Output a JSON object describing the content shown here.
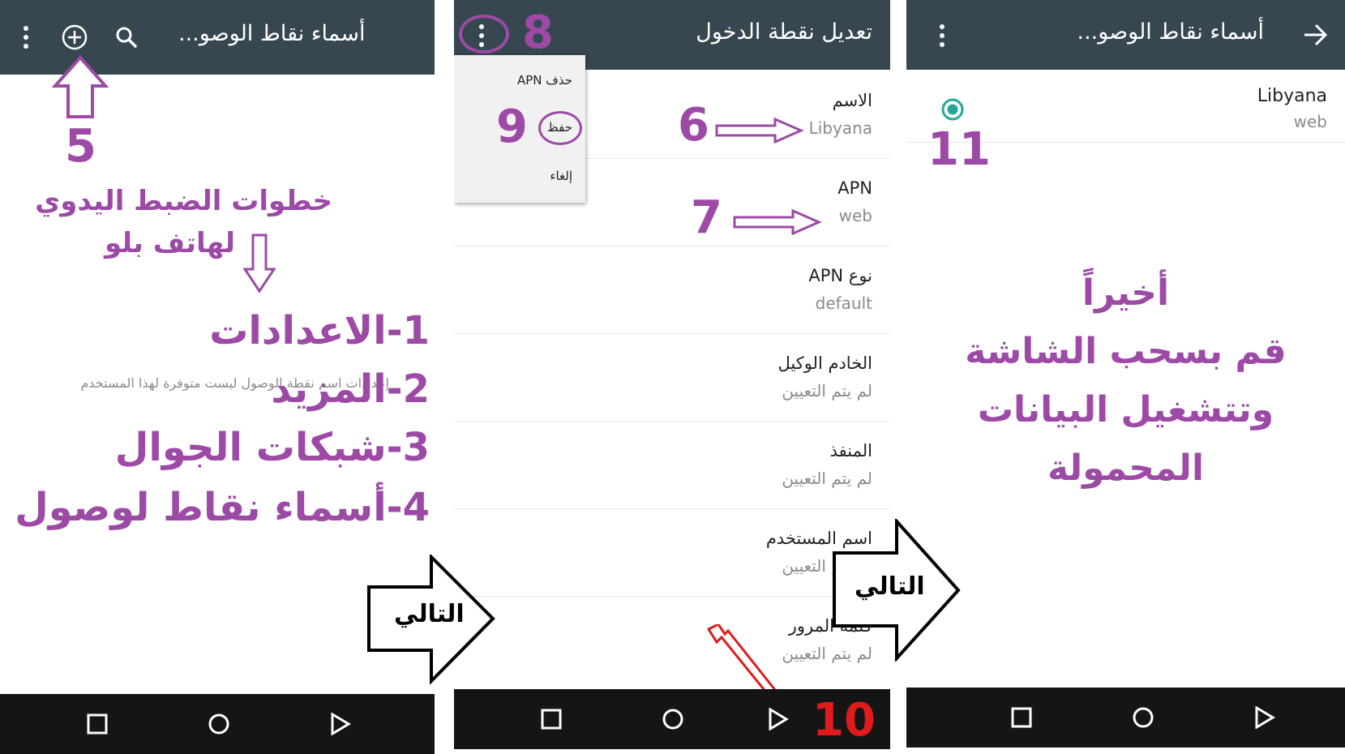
{
  "panel1": {
    "title": "أسماء نقاط الوصو...",
    "empty_message": "إعدادات اسم نقطة الوصول ليست متوفرة لهذا المستخدم",
    "step5": "5",
    "instructions_line1": "خطوات الضبط اليدوي",
    "instructions_line2": "لهاتف بلو",
    "steps": [
      "1-الاعدادات",
      "2-المزيد",
      "3-شبكات الجوال",
      "4-أسماء نقاط لوصول"
    ],
    "next_label": "التالي"
  },
  "panel2": {
    "title": "تعديل نقطة الدخول",
    "step8": "8",
    "menu": {
      "delete": "حذف APN",
      "save": "حفظ",
      "cancel": "إلغاء"
    },
    "step9": "9",
    "step6": "6",
    "step7": "7",
    "step10": "10",
    "fields": [
      {
        "label": "الاسم",
        "value": "Libyana"
      },
      {
        "label": "APN",
        "value": "web"
      },
      {
        "label": "نوع APN",
        "value": "default"
      },
      {
        "label": "الخادم الوكيل",
        "value": "لم يتم التعيين"
      },
      {
        "label": "المنفذ",
        "value": "لم يتم التعيين"
      },
      {
        "label": "اسم المستخدم",
        "value": "لم يتم التعيين"
      },
      {
        "label": "كلمة المرور",
        "value": "لم يتم التعيين"
      }
    ],
    "next_label": "التالي"
  },
  "panel3": {
    "title": "أسماء نقاط الوصو...",
    "apn_name": "Libyana",
    "apn_value": "web",
    "step11": "11",
    "final_lines": [
      "أخيراً",
      "قم بسحب الشاشة",
      "وتتشغيل البيانات",
      "المحمولة"
    ]
  },
  "colors": {
    "toolbar": "#37474f",
    "navbar": "#151515",
    "annotation": "#9c4aa6",
    "radio": "#26a69a",
    "red": "#e01b1b"
  },
  "icons": [
    "more-vert-icon",
    "add-circle-icon",
    "search-icon",
    "back-arrow-icon",
    "square-icon",
    "circle-icon",
    "triangle-icon",
    "up-arrow-icon",
    "down-arrow-icon",
    "right-arrow-icon",
    "radio-selected-icon"
  ]
}
